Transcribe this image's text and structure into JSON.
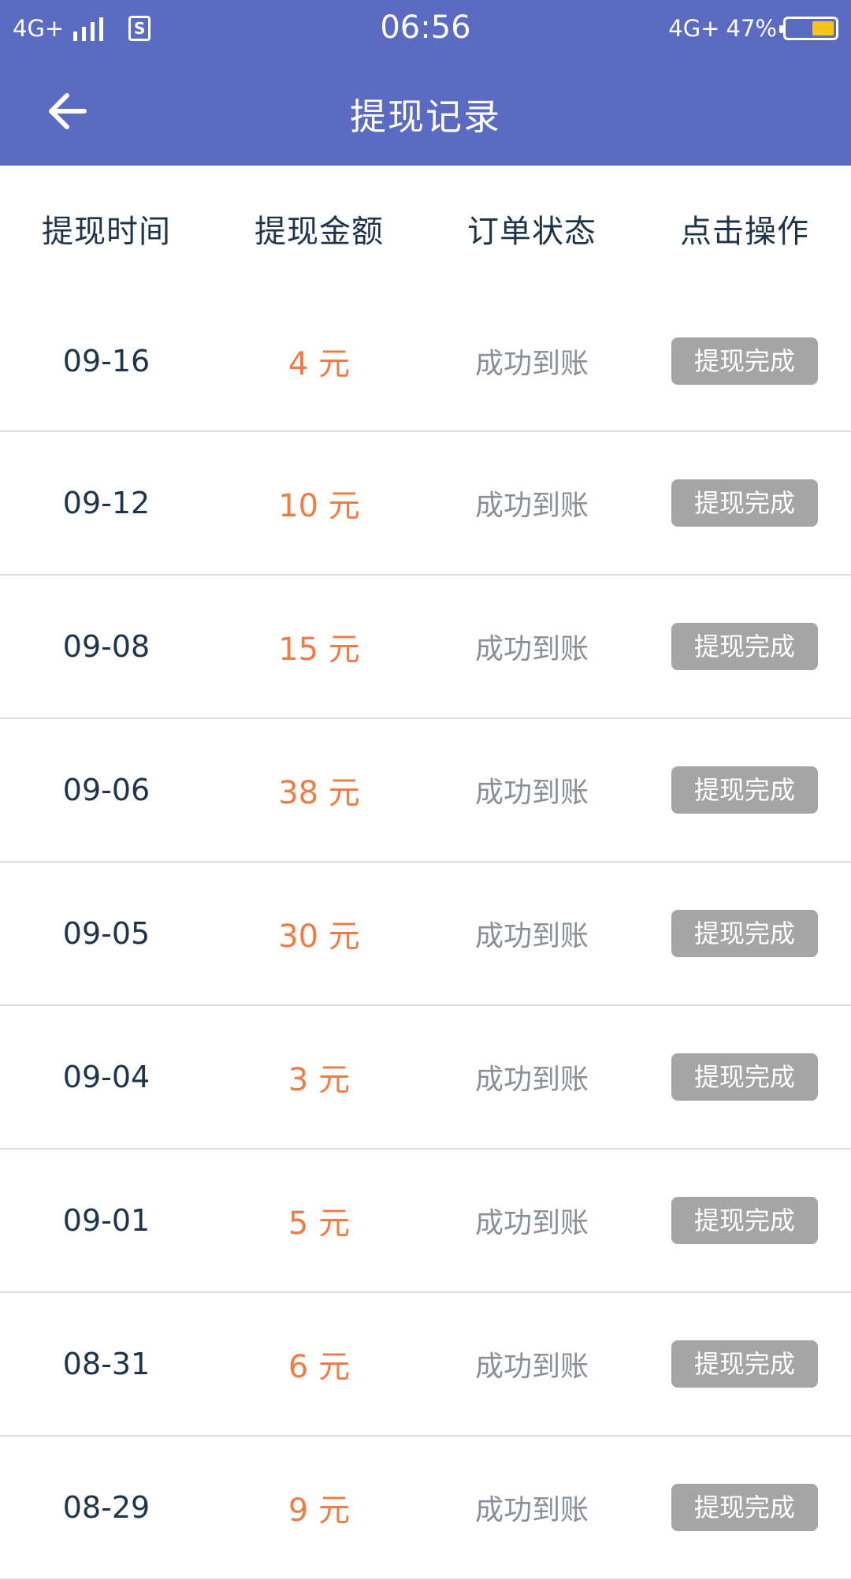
{
  "status_bar": {
    "network_left": "4G+",
    "sim_glyph": "S",
    "time": "06:56",
    "network_right": "4G+",
    "battery": "47%",
    "battery_level": 0.47,
    "accent": "#5b6bc2",
    "battery_color": "#f5c51a"
  },
  "nav": {
    "title": "提现记录",
    "back_icon": "arrow-left-icon"
  },
  "table": {
    "headers": [
      "提现时间",
      "提现金额",
      "订单状态",
      "点击操作"
    ],
    "amount_color": "#ef7c45",
    "rows": [
      {
        "date": "09-16",
        "amount": "4 元",
        "status": "成功到账",
        "action": "提现完成"
      },
      {
        "date": "09-12",
        "amount": "10 元",
        "status": "成功到账",
        "action": "提现完成"
      },
      {
        "date": "09-08",
        "amount": "15 元",
        "status": "成功到账",
        "action": "提现完成"
      },
      {
        "date": "09-06",
        "amount": "38 元",
        "status": "成功到账",
        "action": "提现完成"
      },
      {
        "date": "09-05",
        "amount": "30 元",
        "status": "成功到账",
        "action": "提现完成"
      },
      {
        "date": "09-04",
        "amount": "3 元",
        "status": "成功到账",
        "action": "提现完成"
      },
      {
        "date": "09-01",
        "amount": "5 元",
        "status": "成功到账",
        "action": "提现完成"
      },
      {
        "date": "08-31",
        "amount": "6 元",
        "status": "成功到账",
        "action": "提现完成"
      },
      {
        "date": "08-29",
        "amount": "9 元",
        "status": "成功到账",
        "action": "提现完成"
      }
    ]
  }
}
